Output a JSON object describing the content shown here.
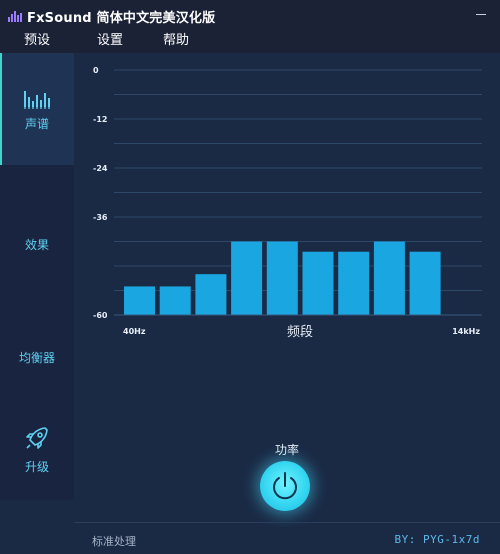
{
  "app": {
    "title": "FxSound 简体中文完美汉化版"
  },
  "menu": [
    "预设",
    "设置",
    "帮助"
  ],
  "sidebar": {
    "items": [
      {
        "label": "声谱",
        "icon": "spectrum-bars-icon",
        "active": true
      },
      {
        "label": "效果",
        "icon": "",
        "active": false
      },
      {
        "label": "均衡器",
        "icon": "",
        "active": false
      },
      {
        "label": "升级",
        "icon": "rocket-icon",
        "active": false
      }
    ]
  },
  "chart_data": {
    "type": "bar",
    "xlabel": "频段",
    "x_tick_labels": [
      "40Hz",
      "14kHz"
    ],
    "y_tick_labels": [
      "0",
      "-12",
      "-24",
      "-36",
      "-60"
    ],
    "ylim": [
      -60,
      0
    ],
    "grid": true,
    "categories": [
      "",
      "",
      "",
      "",
      "",
      "",
      "",
      "",
      ""
    ],
    "values": [
      -53,
      -53,
      -50,
      -42,
      -42,
      -44.5,
      -44.5,
      -42,
      -44.5
    ],
    "bar_color": "#1aa6e0"
  },
  "power": {
    "label": "功率",
    "on": true
  },
  "status": {
    "left": "标准处理",
    "right": "BY: PYG-1x7d"
  },
  "colors": {
    "accent": "#3fd6c9",
    "label": "#5fd0f0",
    "background": "#1a2a45"
  }
}
